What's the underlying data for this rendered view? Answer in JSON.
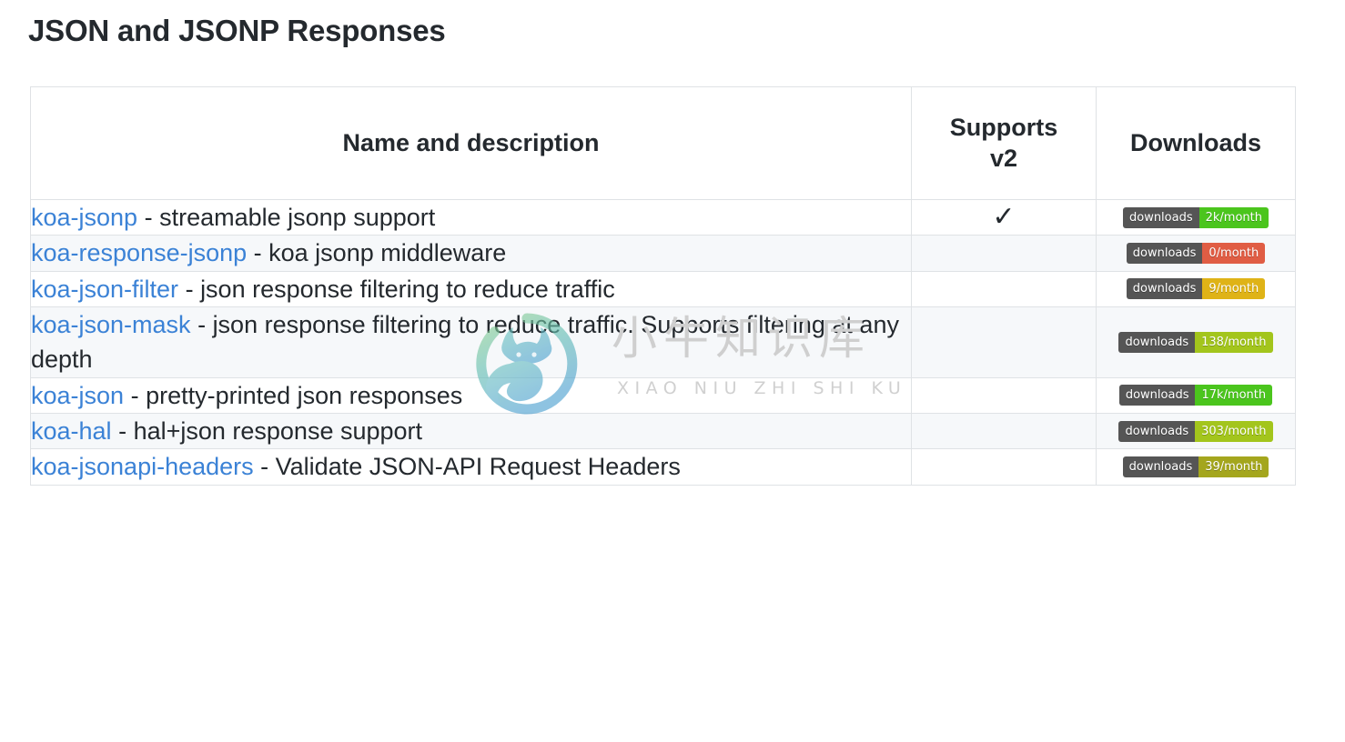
{
  "page_title": "JSON and JSONP Responses",
  "table": {
    "columns": [
      {
        "key": "name",
        "label": "Name and description"
      },
      {
        "key": "supports_v2",
        "label": "Supports v2"
      },
      {
        "key": "downloads",
        "label": "Downloads"
      }
    ],
    "header": {
      "name": "Name and description",
      "supports_v2_line1": "Supports",
      "supports_v2_line2": "v2",
      "downloads": "Downloads"
    },
    "badge_label": "downloads",
    "check_glyph": "✓",
    "rows": [
      {
        "package": "koa-jsonp",
        "separator": " - ",
        "description": "streamable jsonp support",
        "supports_v2": true,
        "downloads_value": "2k/month",
        "downloads_color": "#4bc51d"
      },
      {
        "package": "koa-response-jsonp",
        "separator": " - ",
        "description": "koa jsonp middleware",
        "supports_v2": false,
        "downloads_value": "0/month",
        "downloads_color": "#e05d44"
      },
      {
        "package": "koa-json-filter",
        "separator": " - ",
        "description": "json response filtering to reduce traffic",
        "supports_v2": false,
        "downloads_value": "9/month",
        "downloads_color": "#dfb317"
      },
      {
        "package": "koa-json-mask",
        "separator": " - ",
        "description": "json response filtering to reduce traffic. Supports filtering at any depth",
        "supports_v2": false,
        "downloads_value": "138/month",
        "downloads_color": "#a3c51c"
      },
      {
        "package": "koa-json",
        "separator": " - ",
        "description": "pretty-printed json responses",
        "supports_v2": false,
        "downloads_value": "17k/month",
        "downloads_color": "#4bc51d"
      },
      {
        "package": "koa-hal",
        "separator": " - ",
        "description": "hal+json response support",
        "supports_v2": false,
        "downloads_value": "303/month",
        "downloads_color": "#a3c51c"
      },
      {
        "package": "koa-jsonapi-headers",
        "separator": " - ",
        "description": "Validate JSON-API Request Headers",
        "supports_v2": false,
        "downloads_value": "39/month",
        "downloads_color": "#a4a61d"
      }
    ]
  },
  "watermark": {
    "chinese": "小牛知识库",
    "pinyin": "XIAO NIU ZHI SHI KU"
  },
  "colors": {
    "link": "#3b82d6",
    "text": "#24292e",
    "border": "#dfe2e5",
    "stripe": "#f6f8fa",
    "badge_label_bg": "#555555"
  }
}
